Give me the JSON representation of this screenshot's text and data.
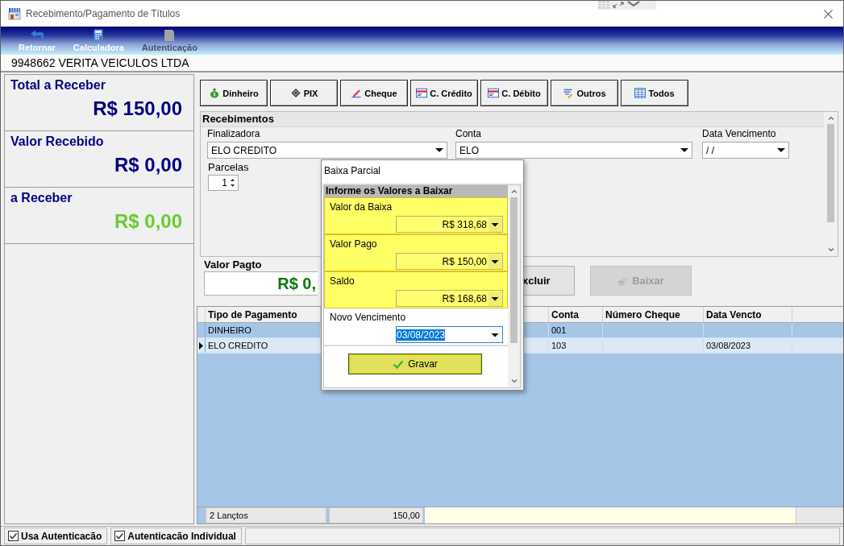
{
  "window": {
    "title": "Recebimento/Pagamento de Títulos"
  },
  "toolbar": [
    {
      "label": "Retornar",
      "kind": "back",
      "disabled": false
    },
    {
      "label": "Calculadora",
      "kind": "calculator",
      "disabled": false
    },
    {
      "label": "Autenticação",
      "kind": "document",
      "disabled": true
    }
  ],
  "customer": "9948662 VERITA VEICULOS LTDA",
  "totals": [
    {
      "label": "Total a Receber",
      "value": "R$ 150,00",
      "color": "#000080"
    },
    {
      "label": "Valor Recebido",
      "value": "R$ 0,00",
      "color": "#000080"
    },
    {
      "label": "a Receber",
      "value": "R$ 0,00",
      "color": "#66cc33"
    }
  ],
  "payment_types": [
    {
      "label": "Dinheiro",
      "kind": "cash"
    },
    {
      "label": "PIX",
      "kind": "pix"
    },
    {
      "label": "Cheque",
      "kind": "cheque"
    },
    {
      "label": "C. Crédito",
      "kind": "card"
    },
    {
      "label": "C. Débito",
      "kind": "card"
    },
    {
      "label": "Outros",
      "kind": "other"
    },
    {
      "label": "Todos",
      "kind": "all"
    }
  ],
  "recebimentos": {
    "title": "Recebimentos",
    "fields": [
      {
        "label": "Finalizadora",
        "value": "ELO CREDITO"
      },
      {
        "label": "Conta",
        "value": "ELO"
      },
      {
        "label": "Data Vencimento",
        "value": "/ /"
      }
    ],
    "parcelas": {
      "label": "Parcelas",
      "value": "1"
    }
  },
  "valor_pagto": {
    "label": "Valor Pagto",
    "value": "R$ 0,"
  },
  "actions": [
    {
      "label": "xcluir",
      "disabled": false
    },
    {
      "label": "Baixar",
      "disabled": true
    }
  ],
  "table": {
    "columns": [
      "Tipo de Pagamento",
      "Conta",
      "Número Cheque",
      "Data Vencto"
    ],
    "rows": [
      {
        "cells": [
          "DINHEIRO",
          "001",
          null,
          null
        ],
        "selected": false
      },
      {
        "cells": [
          "ELO CREDITO",
          "103",
          null,
          "03/08/2023"
        ],
        "selected": true
      }
    ],
    "footer": {
      "count": "2 Lançtos",
      "total": "150,00"
    }
  },
  "dialog": {
    "title": "Baixa Parcial",
    "group": "Informe os Valores a Baixar",
    "fields": [
      {
        "label": "Valor da Baixa",
        "value": "R$ 318,68",
        "highlighted": true,
        "text_selected": false
      },
      {
        "label": "Valor Pago",
        "value": "R$ 150,00",
        "highlighted": true,
        "text_selected": false
      },
      {
        "label": "Saldo",
        "value": "R$ 168,68",
        "highlighted": true,
        "text_selected": false
      },
      {
        "label": "Novo Vencimento",
        "value": "03/08/2023",
        "highlighted": false,
        "text_selected": true
      }
    ],
    "button": "Gravar"
  },
  "options": [
    {
      "label": "Usa Autenticacão",
      "checked": true
    },
    {
      "label": "Autenticacão Individual",
      "checked": true
    }
  ]
}
